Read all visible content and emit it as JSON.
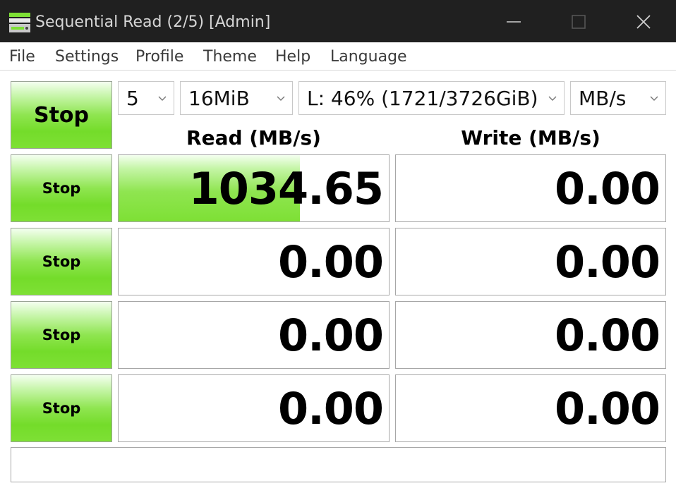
{
  "window": {
    "title": "Sequential Read (2/5) [Admin]",
    "icon": "disk-benchmark-icon"
  },
  "menu": [
    "File",
    "Settings",
    "Profile",
    "Theme",
    "Help",
    "Language"
  ],
  "toolbar": {
    "main_button": "Stop",
    "count": "5",
    "size": "16MiB",
    "drive": "L: 46% (1721/3726GiB)",
    "unit": "MB/s"
  },
  "headers": {
    "read": "Read (MB/s)",
    "write": "Write (MB/s)"
  },
  "rows": [
    {
      "button": "Stop",
      "read": "1034.65",
      "write": "0.00",
      "read_progress": 0.67
    },
    {
      "button": "Stop",
      "read": "0.00",
      "write": "0.00",
      "read_progress": 0
    },
    {
      "button": "Stop",
      "read": "0.00",
      "write": "0.00",
      "read_progress": 0
    },
    {
      "button": "Stop",
      "read": "0.00",
      "write": "0.00",
      "read_progress": 0
    }
  ],
  "status": "",
  "colors": {
    "titlebar": "#202020",
    "button_green": "#74dc2a"
  }
}
